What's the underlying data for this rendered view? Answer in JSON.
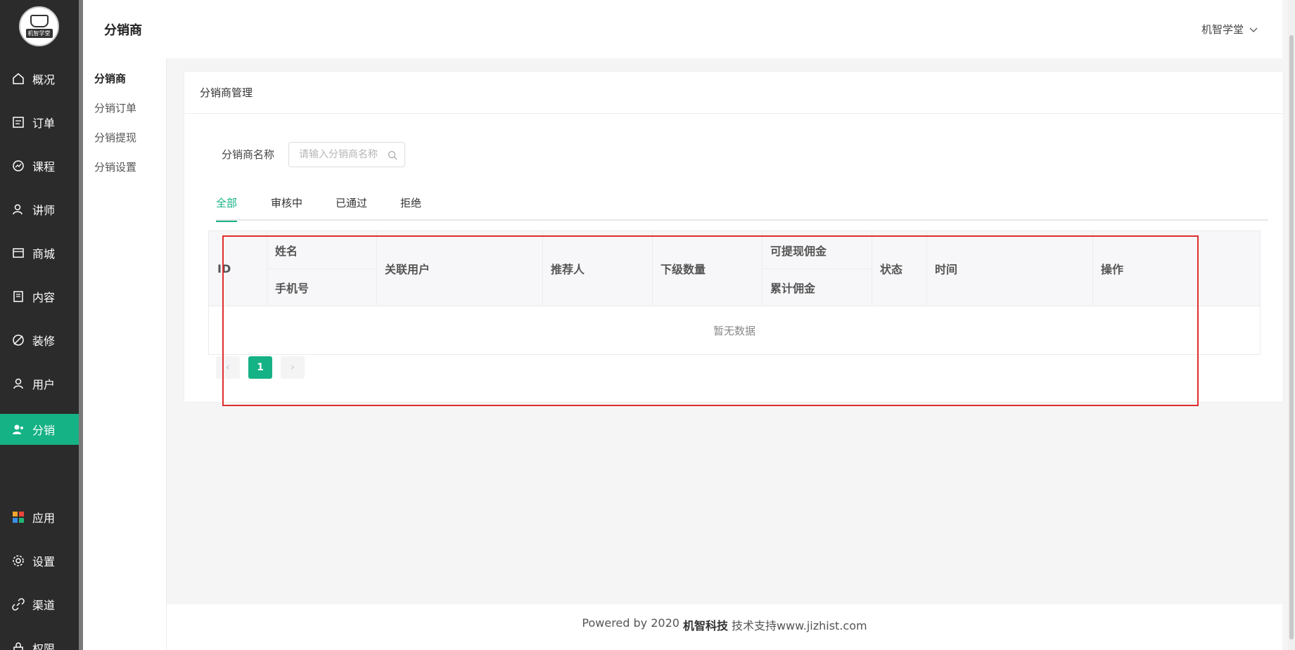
{
  "logo": {
    "text": "机智学堂"
  },
  "sidebar": {
    "items": [
      {
        "label": "概况",
        "icon": "home-icon"
      },
      {
        "label": "订单",
        "icon": "order-icon"
      },
      {
        "label": "课程",
        "icon": "course-icon"
      },
      {
        "label": "讲师",
        "icon": "teacher-icon"
      },
      {
        "label": "商城",
        "icon": "shop-icon"
      },
      {
        "label": "内容",
        "icon": "content-icon"
      },
      {
        "label": "装修",
        "icon": "decorate-icon"
      },
      {
        "label": "用户",
        "icon": "user-icon"
      },
      {
        "label": "分销",
        "icon": "distribution-icon",
        "active": true
      },
      {
        "label": "应用",
        "icon": "apps-icon"
      },
      {
        "label": "设置",
        "icon": "gear-icon"
      },
      {
        "label": "渠道",
        "icon": "link-icon"
      },
      {
        "label": "权限",
        "icon": "permission-icon"
      }
    ]
  },
  "header": {
    "title": "分销商",
    "user": "机智学堂"
  },
  "submenu": {
    "items": [
      {
        "label": "分销商",
        "active": true
      },
      {
        "label": "分销订单"
      },
      {
        "label": "分销提现"
      },
      {
        "label": "分销设置"
      }
    ]
  },
  "card": {
    "title": "分销商管理"
  },
  "filter": {
    "label": "分销商名称",
    "placeholder": "请输入分销商名称",
    "value": ""
  },
  "tabs": [
    {
      "label": "全部",
      "active": true
    },
    {
      "label": "审核中"
    },
    {
      "label": "已通过"
    },
    {
      "label": "拒绝"
    }
  ],
  "table": {
    "headers": {
      "id": "ID",
      "name": "姓名",
      "phone": "手机号",
      "linked_user": "关联用户",
      "referrer": "推荐人",
      "sub_count": "下级数量",
      "withdrawable": "可提现佣金",
      "total_commission": "累计佣金",
      "status": "状态",
      "time": "时间",
      "action": "操作"
    },
    "rows": [],
    "empty_text": "暂无数据"
  },
  "pagination": {
    "current": "1",
    "prev": "‹",
    "next": "›"
  },
  "footer": {
    "prefix": "Powered by 2020",
    "brand": "机智科技",
    "suffix": "技术支持www.jizhist.com"
  },
  "colors": {
    "accent": "#15b285",
    "sidebar_bg": "#2b2b2b",
    "highlight": "#e02d2d"
  }
}
